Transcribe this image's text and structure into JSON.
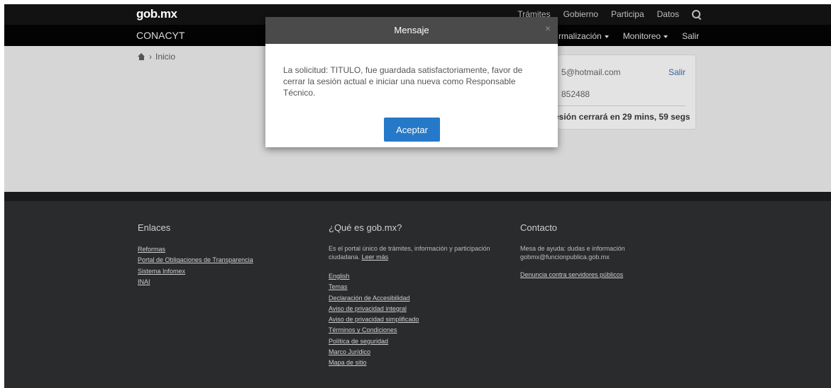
{
  "topbar": {
    "logo": "gob",
    "logo_suffix": "mx",
    "nav": [
      "Trámites",
      "Gobierno",
      "Participa",
      "Datos"
    ]
  },
  "subbar": {
    "brand": "CONACYT",
    "nav": [
      {
        "label": "rmalización",
        "dropdown": true
      },
      {
        "label": "Monitoreo",
        "dropdown": true
      },
      {
        "label": "Salir",
        "dropdown": false
      }
    ]
  },
  "breadcrumb": {
    "label": "Inicio"
  },
  "session": {
    "email": "5@hotmail.com",
    "logout": "Salir",
    "phone": "852488",
    "timer": "esión cerrará en 29 mins, 59 segs"
  },
  "modal": {
    "title": "Mensaje",
    "close": "×",
    "message": "La solicitud: TITULO, fue guardada satisfactoriamente, favor de cerrar la sesión actual e iniciar una nueva como Responsable Técnico.",
    "button": "Aceptar"
  },
  "footer": {
    "col1": {
      "title": "Enlaces",
      "links": [
        "Reformas",
        "Portal de Obligaciones de Transparencia",
        "Sistema Infomex",
        "INAI"
      ]
    },
    "col2": {
      "title": "¿Qué es gob.mx?",
      "description": "Es el portal único de trámites, información y participación ciudadana.",
      "read_more": "Leer más",
      "links": [
        "English",
        "Temas",
        "Declaración de Accesibilidad",
        "Aviso de privacidad integral",
        "Aviso de privacidad simplificado",
        "Términos y Condiciones",
        "Política de seguridad",
        "Marco Jurídico",
        "Mapa de sitio"
      ]
    },
    "col3": {
      "title": "Contacto",
      "line1": "Mesa de ayuda: dudas e información",
      "line2": "gobmx@funcionpublica.gob.mx",
      "links": [
        "Denuncia contra servidores públicos"
      ]
    }
  }
}
